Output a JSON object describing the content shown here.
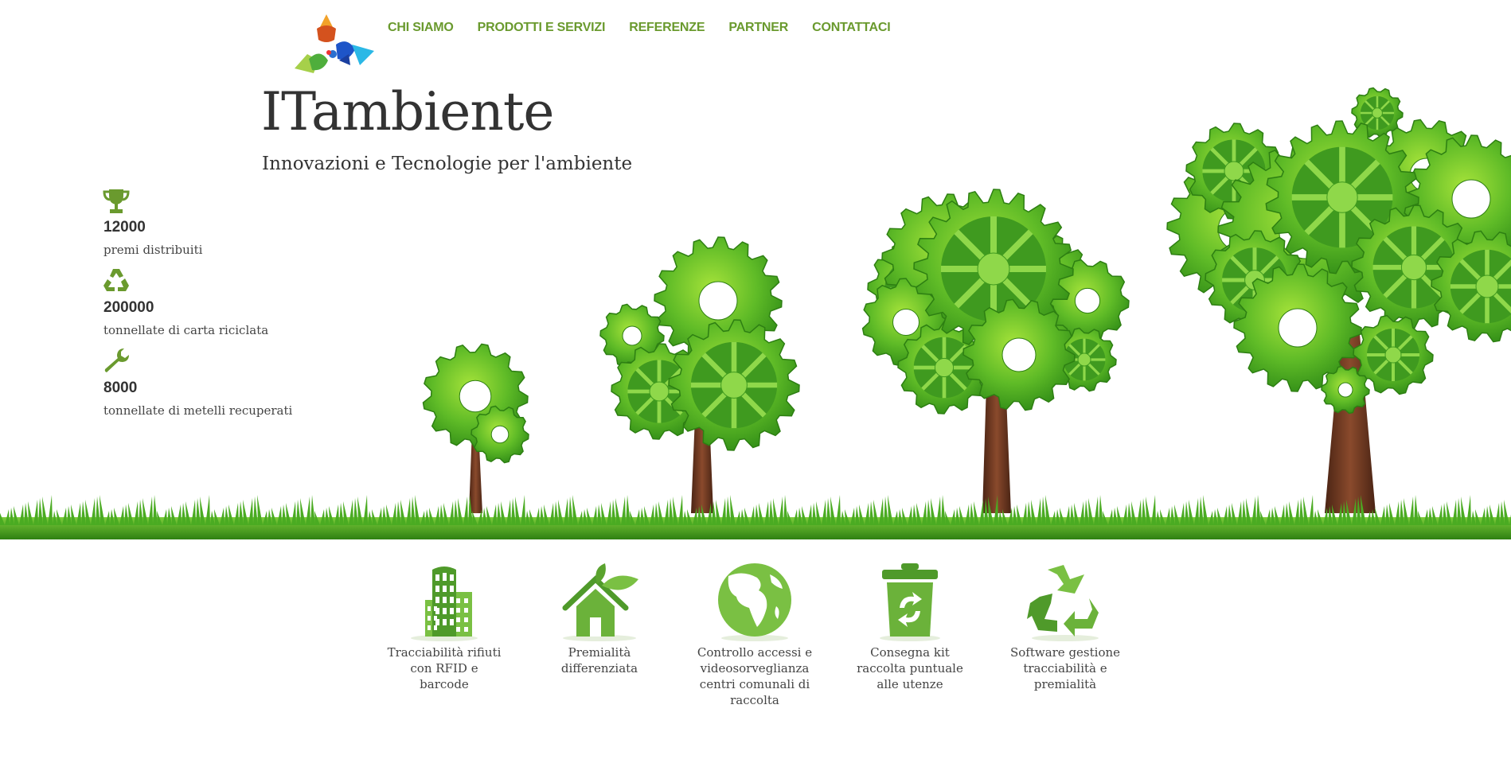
{
  "nav": {
    "items": [
      "CHI SIAMO",
      "PRODOTTI E SERVIZI",
      "REFERENZE",
      "PARTNER",
      "CONTATTACI"
    ]
  },
  "hero": {
    "title": "ITambiente",
    "tagline": "Innovazioni e Tecnologie per l'ambiente"
  },
  "stats": [
    {
      "icon": "trophy-icon",
      "value": "12000",
      "label": "premi distribuiti"
    },
    {
      "icon": "recycle-icon",
      "value": "200000",
      "label": "tonnellate di carta riciclata"
    },
    {
      "icon": "wrench-icon",
      "value": "8000",
      "label": "tonnellate di metelli recuperati"
    }
  ],
  "services": [
    {
      "icon": "buildings-icon",
      "label": "Tracciabilità rifiuti con RFID e barcode"
    },
    {
      "icon": "eco-house-icon",
      "label": "Premialità differenziata"
    },
    {
      "icon": "globe-icon",
      "label": "Controllo accessi e videosorveglianza centri comunali di raccolta"
    },
    {
      "icon": "recycle-bin-icon",
      "label": "Consegna kit raccolta puntuale alle utenze"
    },
    {
      "icon": "recycling-arrows-icon",
      "label": "Software gestione tracciabilità e premialità"
    }
  ],
  "colors": {
    "accent": "#6a9a2e",
    "gear_green": "#5fb830",
    "trunk": "#6b3a22",
    "grass": "#3f9a1a",
    "text": "#333333"
  }
}
